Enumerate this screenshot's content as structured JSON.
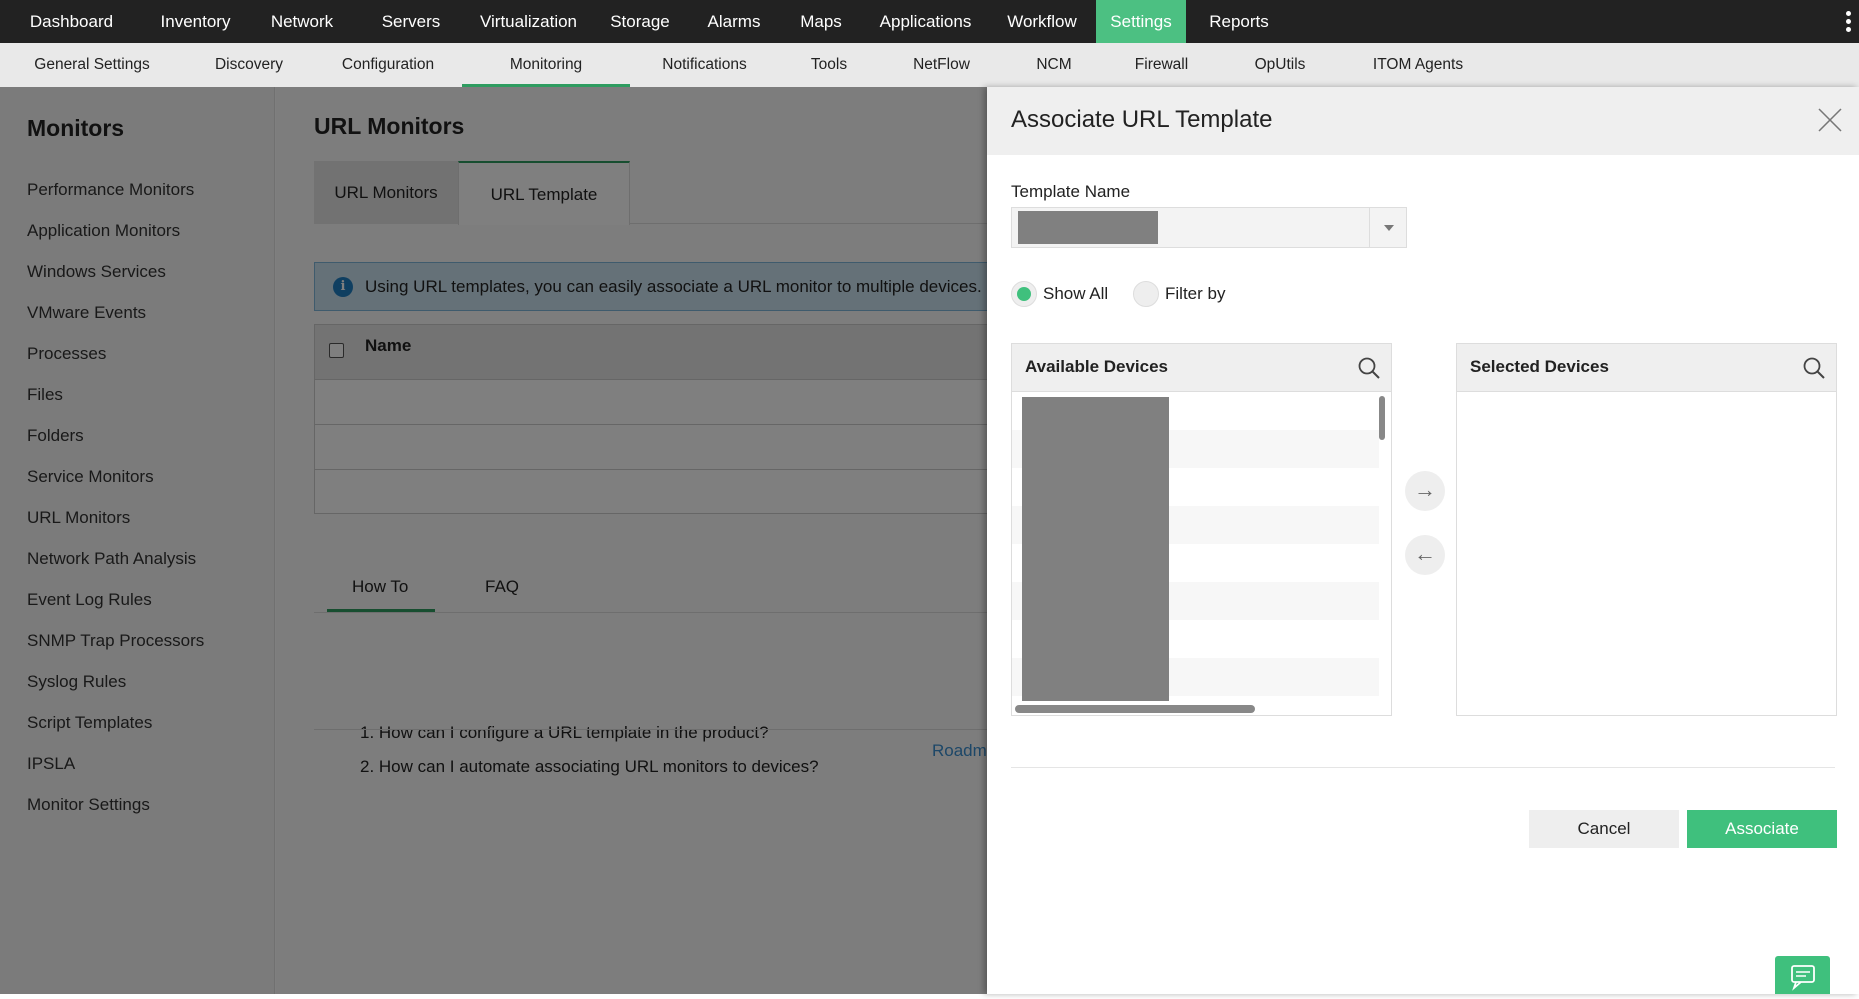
{
  "topnav": {
    "items": [
      "Dashboard",
      "Inventory",
      "Network",
      "Servers",
      "Virtualization",
      "Storage",
      "Alarms",
      "Maps",
      "Applications",
      "Workflow",
      "Settings",
      "Reports"
    ],
    "active": "Settings"
  },
  "subnav": {
    "items": [
      "General Settings",
      "Discovery",
      "Configuration",
      "Monitoring",
      "Notifications",
      "Tools",
      "NetFlow",
      "NCM",
      "Firewall",
      "OpUtils",
      "ITOM Agents"
    ],
    "active": "Monitoring"
  },
  "sidebar": {
    "title": "Monitors",
    "items": [
      "Performance Monitors",
      "Application Monitors",
      "Windows Services",
      "VMware Events",
      "Processes",
      "Files",
      "Folders",
      "Service Monitors",
      "URL Monitors",
      "Network Path Analysis",
      "Event Log Rules",
      "SNMP Trap Processors",
      "Syslog Rules",
      "Script Templates",
      "IPSLA",
      "Monitor Settings"
    ]
  },
  "main": {
    "title": "URL Monitors",
    "tabs": [
      "URL Monitors",
      "URL Template"
    ],
    "active_tab": "URL Template",
    "info": "Using URL templates, you can easily associate a URL monitor to multiple devices.",
    "table_header": "Name",
    "help_tabs": [
      "How To",
      "FAQ"
    ],
    "questions": [
      "1. How can I configure a URL template in the product?",
      "2. How can I automate associating URL monitors to devices?"
    ],
    "roadmap_link": "Roadm"
  },
  "dialog": {
    "title": "Associate URL Template",
    "template_label": "Template Name",
    "radio_show_all": "Show All",
    "radio_filter": "Filter by",
    "selected_radio": "Show All",
    "available_title": "Available Devices",
    "selected_title": "Selected Devices",
    "cancel": "Cancel",
    "associate": "Associate"
  },
  "colors": {
    "accent": "#3fc07d",
    "topnav": "#222222",
    "active_underline": "#2e9c60"
  }
}
